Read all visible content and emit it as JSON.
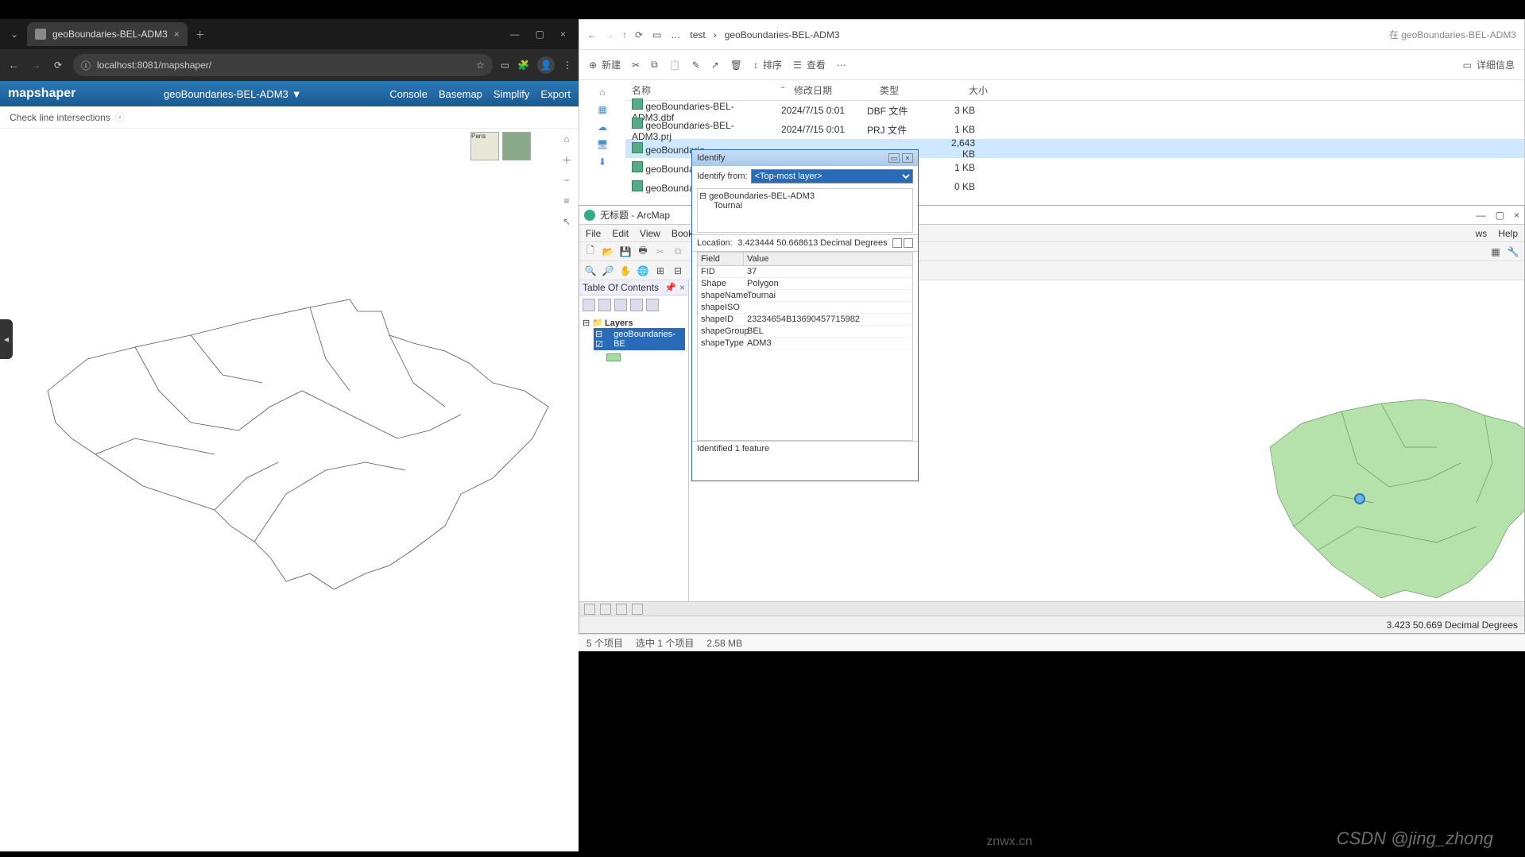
{
  "browser": {
    "tab_title": "geoBoundaries-BEL-ADM3",
    "url": "localhost:8081/mapshaper/",
    "app_title": "mapshaper",
    "layer_name": "geoBoundaries-BEL-ADM3",
    "menu": {
      "console": "Console",
      "basemap": "Basemap",
      "simplify": "Simplify",
      "export": "Export"
    },
    "message": "Check line intersections",
    "preview_label": "Paris"
  },
  "explorer": {
    "path1": "test",
    "path2": "geoBoundaries-BEL-ADM3",
    "search_hint": "在 geoBoundaries-BEL-ADM3",
    "toolbar": {
      "new": "新建",
      "sort": "排序",
      "view": "查看",
      "info": "详细信息"
    },
    "columns": {
      "name": "名称",
      "date": "修改日期",
      "type": "类型",
      "size": "大小"
    },
    "rows": [
      {
        "name": "geoBoundaries-BEL-ADM3.dbf",
        "date": "2024/7/15 0:01",
        "type": "DBF 文件",
        "size": "3 KB"
      },
      {
        "name": "geoBoundaries-BEL-ADM3.prj",
        "date": "2024/7/15 0:01",
        "type": "PRJ 文件",
        "size": "1 KB"
      },
      {
        "name": "geoBoundarie",
        "date": "",
        "type": "",
        "size": "2,643 KB"
      },
      {
        "name": "geoBoundarie",
        "date": "",
        "type": "",
        "size": "1 KB"
      },
      {
        "name": "geoBoundarie",
        "date": "",
        "type": "",
        "size": "0 KB"
      }
    ],
    "status": {
      "count": "5 个项目",
      "selected": "选中 1 个项目",
      "size": "2.58 MB"
    }
  },
  "arcmap": {
    "title": "无标题 - ArcMap",
    "menu": {
      "file": "File",
      "edit": "Edit",
      "view": "View",
      "bookmarks": "Bookma",
      "windows": "ws",
      "help": "Help"
    },
    "toc_title": "Table Of Contents",
    "layers_label": "Layers",
    "layer_name": "geoBoundaries-BE",
    "coord": "3.423  50.669 Decimal Degrees"
  },
  "identify": {
    "title": "Identify",
    "from_label": "Identify from:",
    "from_value": "<Top-most layer>",
    "tree_layer": "geoBoundaries-BEL-ADM3",
    "tree_feature": "Tournai",
    "location_label": "Location:",
    "location_value": "3.423444  50.668613 Decimal Degrees",
    "field_hdr": "Field",
    "value_hdr": "Value",
    "fields": [
      {
        "f": "FID",
        "v": "37"
      },
      {
        "f": "Shape",
        "v": "Polygon"
      },
      {
        "f": "shapeName",
        "v": "Tournai"
      },
      {
        "f": "shapeISO",
        "v": ""
      },
      {
        "f": "shapeID",
        "v": "23234654B13690457715982"
      },
      {
        "f": "shapeGroup",
        "v": "BEL"
      },
      {
        "f": "shapeType",
        "v": "ADM3"
      }
    ],
    "footer": "Identified 1 feature"
  },
  "watermark": "CSDN @jing_zhong",
  "watermark2": "znwx.cn"
}
